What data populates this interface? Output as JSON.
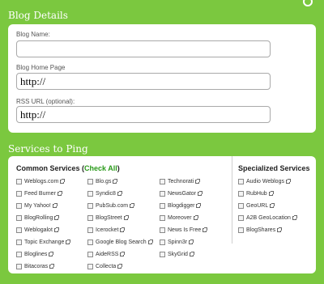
{
  "blog_details": {
    "title": "Blog Details",
    "name_label": "Blog Name:",
    "name_value": "",
    "home_label": "Blog Home Page",
    "home_value": "http://",
    "rss_label": "RSS URL (optional):",
    "rss_value": "http://"
  },
  "ping": {
    "title": "Services to Ping",
    "common_heading": "Common Services (",
    "check_all": "Check All",
    "common_heading_end": ")",
    "special_heading": "Specialized Services",
    "col1": [
      "Weblogs.com",
      "Feed Burner",
      "My Yahoo!",
      "BlogRolling",
      "Weblogalot",
      "Topic Exchange",
      "Bloglines",
      "Bitacoras"
    ],
    "col2": [
      "Blo.gs",
      "Syndic8",
      "PubSub.com",
      "BlogStreet",
      "Icerocket",
      "Google Blog Search",
      "AideRSS",
      "Collecta"
    ],
    "col3": [
      "Technorati",
      "NewsGator",
      "Blogdigger",
      "Moreover",
      "News Is Free",
      "Spinn3r",
      "SkyGrid"
    ],
    "special": [
      "Audio Weblogs",
      "RubHub",
      "GeoURL",
      "A2B GeoLocation",
      "BlogShares"
    ]
  }
}
